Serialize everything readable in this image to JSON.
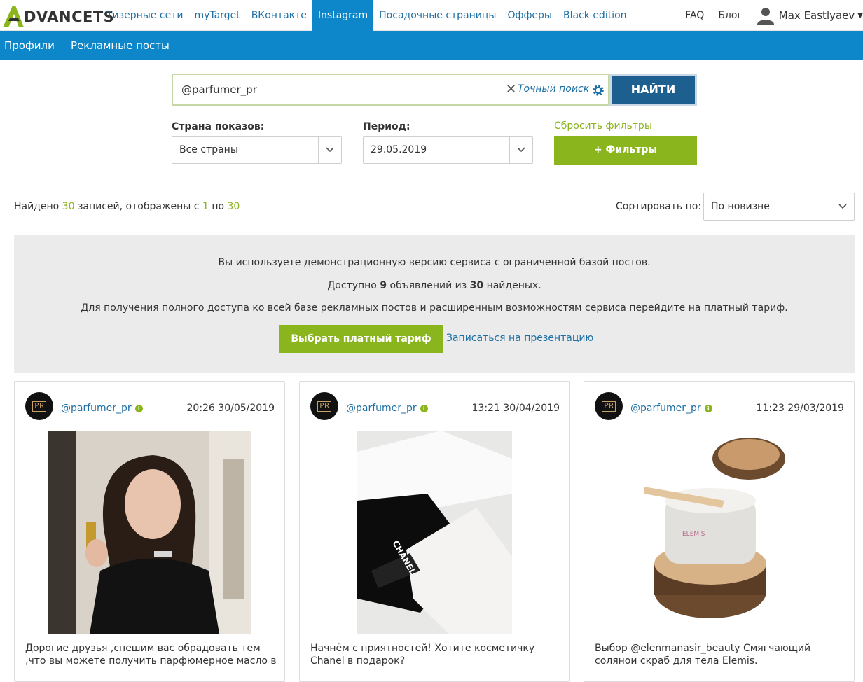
{
  "brand": {
    "name": "DVANCETS",
    "accent": "#8ab51d",
    "blue": "#0d87c9"
  },
  "nav": {
    "items": [
      "Тизерные сети",
      "myTarget",
      "ВКонтакте",
      "Instagram",
      "Посадочные страницы",
      "Офферы",
      "Black edition"
    ],
    "active": "Instagram",
    "faq": "FAQ",
    "blog": "Блог",
    "user": "Max Eastlyaev"
  },
  "subnav": {
    "profiles": "Профили",
    "posts": "Рекламные посты"
  },
  "search": {
    "value": "@parfumer_pr",
    "exact_label": "Точный поиск",
    "button": "НАЙТИ"
  },
  "filters": {
    "country_label": "Страна показов:",
    "country_value": "Все страны",
    "period_label": "Период:",
    "period_value": "29.05.2019",
    "reset": "Сбросить фильтры",
    "more": "+ Фильтры"
  },
  "results": {
    "found_prefix": "Найдено",
    "total": "30",
    "middle": "записей, отображены с",
    "from": "1",
    "to_word": "по",
    "to": "30",
    "sort_label": "Сортировать по:",
    "sort_value": "По новизне"
  },
  "demo": {
    "line1": "Вы используете демонстрационную версию сервиса с ограниченной базой постов.",
    "line2_a": "Доступно",
    "line2_n1": "9",
    "line2_b": "объявлений из",
    "line2_n2": "30",
    "line2_c": "найденых.",
    "line3": "Для получения полного доступа ко всей базе рекламных постов и расширенным возможностям сервиса перейдите на платный тариф.",
    "paid_button": "Выбрать платный тариф",
    "presentation": "Записаться на презентацию"
  },
  "cards": [
    {
      "handle": "@parfumer_pr",
      "date": "20:26 30/05/2019",
      "caption": "Дорогие друзья ,спешим вас обрадовать тем ,что вы можете получить парфюмерное масло в"
    },
    {
      "handle": "@parfumer_pr",
      "date": "13:21 30/04/2019",
      "caption": "Начнём с приятностей! Хотите косметичку Chanel в подарок?"
    },
    {
      "handle": "@parfumer_pr",
      "date": "11:23 29/03/2019",
      "caption": "Выбор @elenmanasir_beauty Смягчающий соляной скраб для тела Elemis."
    }
  ],
  "avatar_text": "PR",
  "photo_text": {
    "chanel": "CHANEL",
    "elemis": "ELEMIS"
  }
}
